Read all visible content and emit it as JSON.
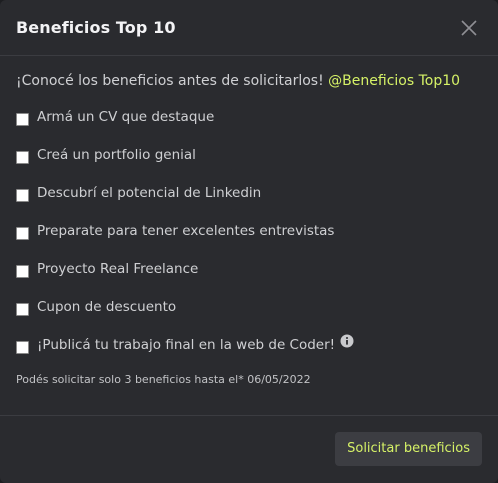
{
  "modal": {
    "title": "Beneficios Top 10",
    "intro_text": "¡Conocé los beneficios antes de solicitarlos! ",
    "intro_link": "@Beneficios Top10",
    "options": [
      {
        "label": "Armá un CV que destaque"
      },
      {
        "label": "Creá un portfolio genial"
      },
      {
        "label": "Descubrí el potencial de Linkedin"
      },
      {
        "label": "Preparate para tener excelentes entrevistas"
      },
      {
        "label": "Proyecto Real Freelance"
      },
      {
        "label": "Cupon de descuento"
      },
      {
        "label": "¡Publicá tu trabajo final en la web de Coder!",
        "has_info": true
      }
    ],
    "note": "Podés solicitar solo 3 beneficios hasta el* 06/05/2022",
    "submit_label": "Solicitar beneficios"
  },
  "icons": {
    "close": "close-icon",
    "info": "info-icon"
  },
  "colors": {
    "background": "#2a2b2f",
    "accent": "#d6f267",
    "button_bg": "#3c3d42",
    "divider": "#3b3c41"
  }
}
